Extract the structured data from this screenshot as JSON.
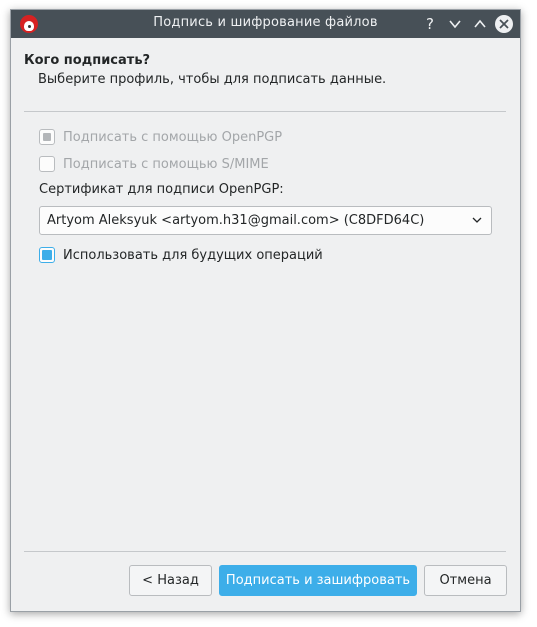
{
  "window": {
    "title": "Подпись и шифрование файлов",
    "buttons": {
      "help": "?",
      "minimize": "chevron-down-icon",
      "maximize": "chevron-up-icon",
      "close": "close-icon"
    }
  },
  "header": {
    "title": "Кого подписать?",
    "subtitle": "Выберите профиль, чтобы для подписать данные."
  },
  "options": {
    "sign_openpgp": {
      "label": "Подписать с помощью OpenPGP",
      "checked": true,
      "enabled": false
    },
    "sign_smime": {
      "label": "Подписать с помощью S/MIME",
      "checked": false,
      "enabled": false
    },
    "certificate_label": "Сертификат для подписи OpenPGP:",
    "certificate_value": "Artyom Aleksyuk <artyom.h31@gmail.com> (C8DFD64C)",
    "remember": {
      "label": "Использовать для будущих операций",
      "checked": true,
      "enabled": true
    }
  },
  "footer": {
    "back_label": "< Назад",
    "sign_encrypt_label": "Подписать и зашифровать",
    "cancel_label": "Отмена"
  },
  "colors": {
    "titlebar": "#475057",
    "window_bg": "#eff0f1",
    "accent": "#3daee9",
    "disabled_text": "#a3a6a9"
  }
}
